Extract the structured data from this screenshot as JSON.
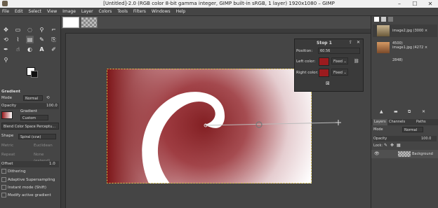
{
  "window": {
    "title": "[Untitled]-2.0 (RGB color 8-bit gamma integer, GIMP built-in sRGB, 1 layer) 1920x1080 – GIMP",
    "minimize": "–",
    "maximize": "☐",
    "close": "✕"
  },
  "menu": [
    "File",
    "Edit",
    "Select",
    "View",
    "Image",
    "Layer",
    "Colors",
    "Tools",
    "Filters",
    "Windows",
    "Help"
  ],
  "tool_options": {
    "heading": "Gradient",
    "mode_label": "Mode",
    "mode_value": "Normal",
    "opacity_label": "Opacity",
    "opacity_value": "100.0",
    "gradient_label": "Gradient",
    "gradient_value": "Custom",
    "blend_space": "Blend Color Space Perceptu...",
    "shape_label": "Shape",
    "shape_value": "Spiral (ccw)",
    "metric_label": "Metric",
    "metric_value": "Euclidean",
    "repeat_label": "Repeat",
    "repeat_value": "None (extend)",
    "offset_label": "Offset",
    "offset_value": "1.0",
    "dithering": "Dithering",
    "adaptive": "Adaptive Supersampling",
    "instant": "Instant mode (Shift)",
    "modify": "Modify active gradient"
  },
  "stop_dialog": {
    "title": "Stop 1",
    "position_label": "Position:",
    "position_value": "60.56",
    "left_label": "Left color:",
    "left_mode": "Fixed",
    "right_label": "Right color:",
    "right_mode": "Fixed",
    "delete_icon": "⊠",
    "stop_color": "#9b1b1e"
  },
  "images_panel": {
    "items": [
      {
        "label": "image2.jpg (3000 × 4500)"
      },
      {
        "label": "image1.jpg (4272 × 2848)"
      }
    ]
  },
  "layers_panel": {
    "tabs": [
      "Layers",
      "Channels",
      "Paths"
    ],
    "mode_label": "Mode",
    "mode_value": "Normal",
    "opacity_label": "Opacity",
    "opacity_value": "100.0",
    "lock_label": "Lock:",
    "layer_name": "Background"
  },
  "colors": {
    "accent": "#9b1b1e",
    "canvas_bg": "#454545"
  }
}
